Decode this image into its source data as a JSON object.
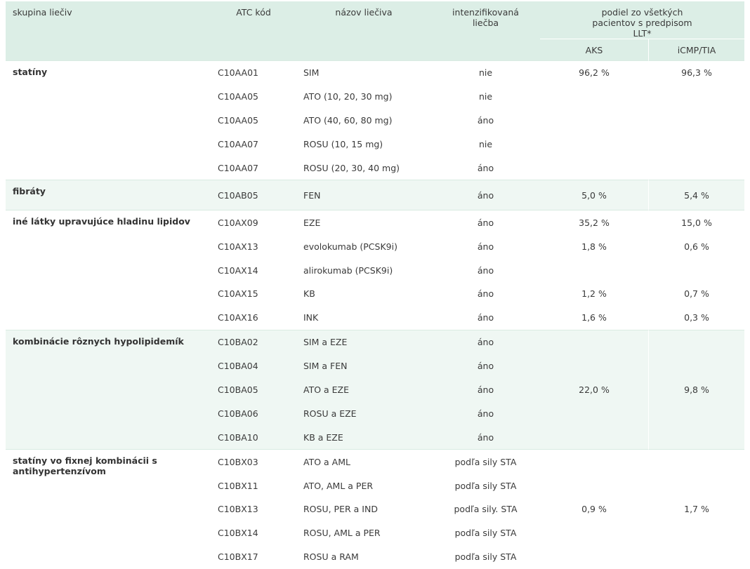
{
  "header": {
    "col_group": "skupina liečiv",
    "col_atc": "ATC kód",
    "col_name": "názov liečiva",
    "col_intens": "intenzifikovaná liečba",
    "col_share": "podiel zo všetkých pacientov s predpisom LLT*",
    "col_aks": "AKS",
    "col_icmp": "iCMP/TIA"
  },
  "groups": [
    {
      "name": "statíny",
      "rows": [
        {
          "atc": "C10AA01",
          "name": "SIM",
          "intens": "nie",
          "aks": "96,2 %",
          "icmp": "96,3 %"
        },
        {
          "atc": "C10AA05",
          "name": "ATO (10, 20, 30 mg)",
          "intens": "nie",
          "aks": "",
          "icmp": ""
        },
        {
          "atc": "C10AA05",
          "name": "ATO (40, 60, 80 mg)",
          "intens": "áno",
          "aks": "",
          "icmp": ""
        },
        {
          "atc": "C10AA07",
          "name": "ROSU (10, 15 mg)",
          "intens": "nie",
          "aks": "",
          "icmp": ""
        },
        {
          "atc": "C10AA07",
          "name": "ROSU (20, 30, 40 mg)",
          "intens": "áno",
          "aks": "",
          "icmp": ""
        }
      ]
    },
    {
      "name": "fibráty",
      "rows": [
        {
          "atc": "C10AB05",
          "name": "FEN",
          "intens": "áno",
          "aks": "5,0 %",
          "icmp": "5,4 %"
        }
      ]
    },
    {
      "name": "iné látky upravujúce hladinu lipidov",
      "rows": [
        {
          "atc": "C10AX09",
          "name": "EZE",
          "intens": "áno",
          "aks": "35,2 %",
          "icmp": "15,0 %"
        },
        {
          "atc": "C10AX13",
          "name": "evolokumab (PCSK9i)",
          "intens": "áno",
          "aks": "1,8 %",
          "icmp": "0,6 %"
        },
        {
          "atc": "C10AX14",
          "name": "alirokumab (PCSK9i)",
          "intens": "áno",
          "aks": "",
          "icmp": ""
        },
        {
          "atc": "C10AX15",
          "name": "KB",
          "intens": "áno",
          "aks": "1,2 %",
          "icmp": "0,7 %"
        },
        {
          "atc": "C10AX16",
          "name": "INK",
          "intens": "áno",
          "aks": "1,6 %",
          "icmp": "0,3 %"
        }
      ]
    },
    {
      "name": "kombinácie rôznych hypolipidemík",
      "merged": {
        "aks": "22,0 %",
        "icmp": "9,8 %"
      },
      "rows": [
        {
          "atc": "C10BA02",
          "name": "SIM a EZE",
          "intens": "áno"
        },
        {
          "atc": "C10BA04",
          "name": "SIM a FEN",
          "intens": "áno"
        },
        {
          "atc": "C10BA05",
          "name": "ATO a EZE",
          "intens": "áno"
        },
        {
          "atc": "C10BA06",
          "name": "ROSU a EZE",
          "intens": "áno"
        },
        {
          "atc": "C10BA10",
          "name": "KB a EZE",
          "intens": "áno"
        }
      ]
    },
    {
      "name": "statíny vo fixnej kombinácii s antihypertenzívom",
      "merged": {
        "aks": "0,9 %",
        "icmp": "1,7 %"
      },
      "rows": [
        {
          "atc": "C10BX03",
          "name": "ATO a AML",
          "intens": "podľa sily STA"
        },
        {
          "atc": "C10BX11",
          "name": "ATO, AML a PER",
          "intens": "podľa sily STA"
        },
        {
          "atc": "C10BX13",
          "name": "ROSU, PER a IND",
          "intens": "podľa sily. STA"
        },
        {
          "atc": "C10BX14",
          "name": "ROSU, AML a PER",
          "intens": "podľa sily STA"
        },
        {
          "atc": "C10BX17",
          "name": "ROSU a RAM",
          "intens": "podľa sily STA"
        }
      ]
    }
  ]
}
